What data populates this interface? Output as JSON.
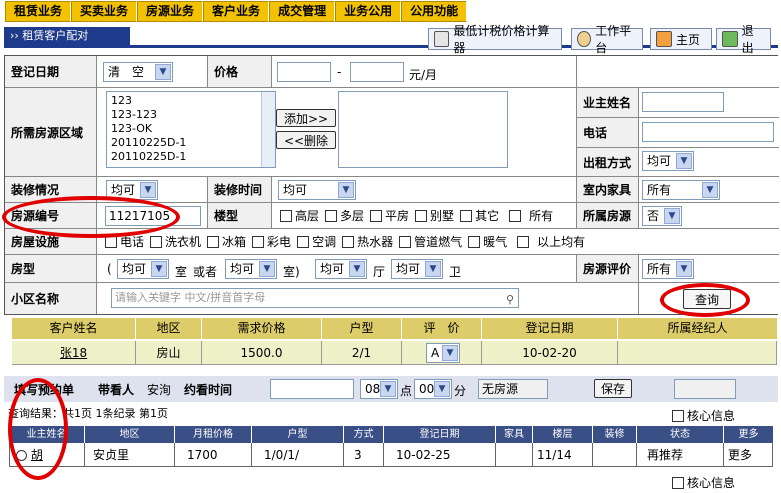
{
  "menu": [
    "租赁业务",
    "买卖业务",
    "房源业务",
    "客户业务",
    "成交管理",
    "业务公用",
    "公用功能"
  ],
  "page_title": "›› 租赁客户配对",
  "toolbar": {
    "calc": "最低计税价格计算器",
    "workbench": "工作平台",
    "home": "主页",
    "exit": "退出"
  },
  "form": {
    "reg_date_label": "登记日期",
    "reg_date_value": "清　空",
    "price_label": "价格",
    "price_dash": "-",
    "price_unit": "元/月",
    "area_label": "所需房源区域",
    "area_list": [
      "123",
      "123-123",
      "123-OK",
      "20110225D-1",
      "20110225D-1"
    ],
    "add_btn": "添加>>",
    "del_btn": "<<删除",
    "owner_label": "业主姓名",
    "phone_label": "电话",
    "rent_label": "出租方式",
    "rent_value": "均可",
    "deco_label": "装修情况",
    "deco_value": "均可",
    "deco_time_label": "装修时间",
    "deco_time_value": "均可",
    "furn_label": "室内家具",
    "furn_value": "所有",
    "code_label": "房源编号",
    "code_value": "11217105",
    "building_label": "楼型",
    "building_opts": [
      "高层",
      "多层",
      "平房",
      "别墅",
      "其它",
      "所有"
    ],
    "owned_label": "所属房源",
    "owned_value": "否",
    "facility_label": "房屋设施",
    "facility_opts": [
      "电话",
      "洗衣机",
      "冰箱",
      "彩电",
      "空调",
      "热水器",
      "管道燃气",
      "暖气",
      "以上均有"
    ],
    "type_label": "房型",
    "type_open": "(",
    "room_value": "均可",
    "room_unit": "室",
    "or": "或者",
    "room2_value": "均可",
    "room2_unit": "室)",
    "hall_value": "均可",
    "hall_unit": "厅",
    "bath_value": "均可",
    "bath_unit": "卫",
    "eval_label": "房源评价",
    "eval_value": "所有",
    "community_label": "小区名称",
    "community_placeholder": "请输入关键字 中文/拼音首字母",
    "query_btn": "查询"
  },
  "client_table": {
    "headers": [
      "客户姓名",
      "地区",
      "需求价格",
      "户型",
      "评　价",
      "登记日期",
      "所属经纪人"
    ],
    "row": [
      "张18",
      "房山",
      "1500.0",
      "2/1",
      "A",
      "10-02-20",
      ""
    ]
  },
  "appoint": {
    "label": "填写预约单",
    "viewer_label": "带看人",
    "viewer": "安洵",
    "time_label": "约看时间",
    "hour": "08",
    "dot": "点",
    "min": "00",
    "min_unit": "分",
    "source": "无房源",
    "save": "保存"
  },
  "result": {
    "summary": "查询结果：共1页 1条纪录 第1页",
    "core_info": "核心信息",
    "headers": [
      "业主姓名",
      "地区",
      "月租价格",
      "户型",
      "方式",
      "登记日期",
      "家具",
      "楼层",
      "装修",
      "状态",
      "更多"
    ],
    "row": [
      "胡",
      "安贞里",
      "1700",
      "1/0/1/",
      "3",
      "10-02-25",
      "",
      "11/14",
      "",
      "再推荐",
      "更多"
    ]
  }
}
